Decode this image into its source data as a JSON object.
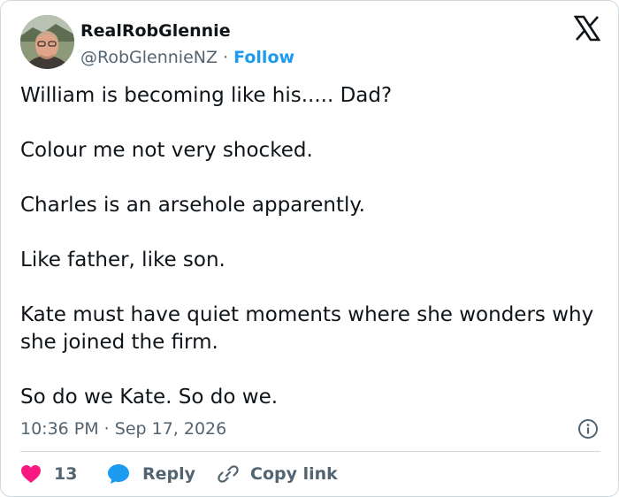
{
  "author": {
    "display_name": "RealRobGlennie",
    "handle": "@RobGlennieNZ",
    "separator": "·",
    "follow_label": "Follow"
  },
  "tweet": {
    "paragraphs": [
      "William is becoming like his..... Dad?",
      "Colour me not very shocked.",
      "Charles is an arsehole apparently.",
      "Like father, like son.",
      "Kate must have quiet moments where she wonders why she joined the firm.",
      "So do we Kate. So do we."
    ],
    "timestamp": "10:36 PM · Sep 17, 2026"
  },
  "actions": {
    "like_count": "13",
    "reply_label": "Reply",
    "copy_link_label": "Copy link"
  },
  "icons": {
    "brand": "x-logo-icon",
    "info": "info-icon",
    "like": "heart-icon",
    "reply": "speech-bubble-icon",
    "copy": "link-icon"
  },
  "colors": {
    "text": "#0f1419",
    "secondary": "#536471",
    "accent": "#1d9bf0",
    "like": "#f91880",
    "border": "#cfd9de"
  }
}
